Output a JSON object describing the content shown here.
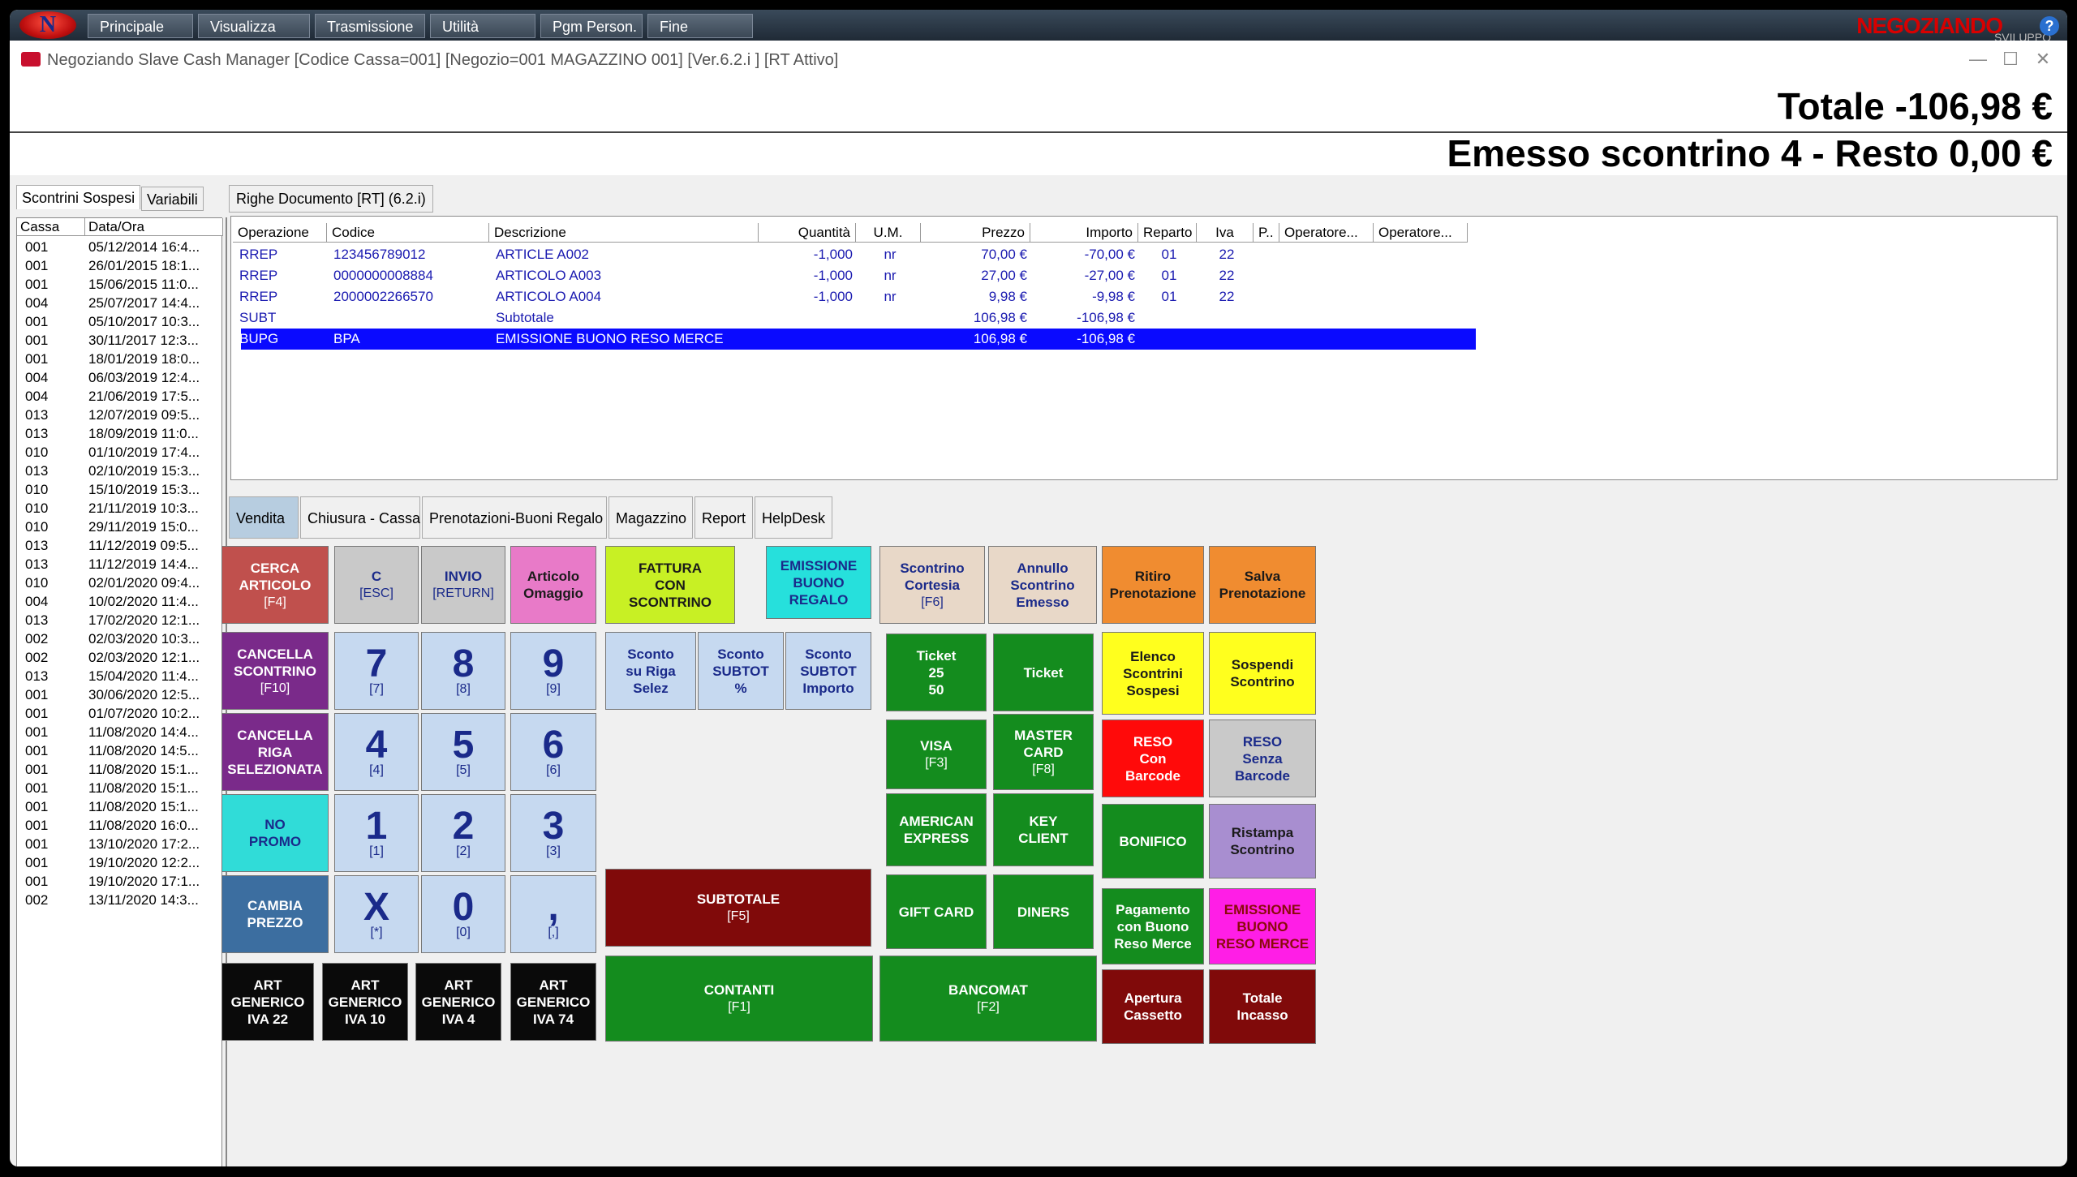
{
  "menubar": {
    "items": [
      "Principale",
      "Visualizza",
      "Trasmissione",
      "Utilità",
      "Pgm Person.",
      "Fine"
    ],
    "brand": "NEGOZIANDO",
    "brand_sub": "SVILUPPO",
    "logo": "N"
  },
  "window": {
    "title": "Negoziando Slave Cash Manager [Codice Cassa=001] [Negozio=001 MAGAZZINO 001] [Ver.6.2.i ] [RT Attivo]"
  },
  "totals": {
    "totale": "Totale -106,98 €",
    "emesso": "Emesso scontrino 4 - Resto  0,00 €"
  },
  "left_panel": {
    "tabs": [
      "Scontrini Sospesi",
      "Variabili"
    ],
    "headers": [
      "Cassa",
      "Data/Ora"
    ],
    "rows": [
      [
        "001",
        "05/12/2014 16:4..."
      ],
      [
        "001",
        "26/01/2015 18:1..."
      ],
      [
        "001",
        "15/06/2015 11:0..."
      ],
      [
        "004",
        "25/07/2017 14:4..."
      ],
      [
        "001",
        "05/10/2017 10:3..."
      ],
      [
        "001",
        "30/11/2017 12:3..."
      ],
      [
        "001",
        "18/01/2019 18:0..."
      ],
      [
        "004",
        "06/03/2019 12:4..."
      ],
      [
        "004",
        "21/06/2019 17:5..."
      ],
      [
        "013",
        "12/07/2019 09:5..."
      ],
      [
        "013",
        "18/09/2019 11:0..."
      ],
      [
        "010",
        "01/10/2019 17:4..."
      ],
      [
        "013",
        "02/10/2019 15:3..."
      ],
      [
        "010",
        "15/10/2019 15:3..."
      ],
      [
        "010",
        "21/11/2019 10:3..."
      ],
      [
        "010",
        "29/11/2019 15:0..."
      ],
      [
        "013",
        "11/12/2019 09:5..."
      ],
      [
        "013",
        "11/12/2019 14:4..."
      ],
      [
        "010",
        "02/01/2020 09:4..."
      ],
      [
        "004",
        "10/02/2020 11:4..."
      ],
      [
        "013",
        "17/02/2020 12:1..."
      ],
      [
        "002",
        "02/03/2020 10:3..."
      ],
      [
        "002",
        "02/03/2020 12:1..."
      ],
      [
        "013",
        "15/04/2020 11:4..."
      ],
      [
        "001",
        "30/06/2020 12:5..."
      ],
      [
        "001",
        "01/07/2020 10:2..."
      ],
      [
        "001",
        "11/08/2020 14:4..."
      ],
      [
        "001",
        "11/08/2020 14:5..."
      ],
      [
        "001",
        "11/08/2020 15:1..."
      ],
      [
        "001",
        "11/08/2020 15:1..."
      ],
      [
        "001",
        "11/08/2020 15:1..."
      ],
      [
        "001",
        "11/08/2020 16:0..."
      ],
      [
        "001",
        "13/10/2020 17:2..."
      ],
      [
        "001",
        "19/10/2020 12:2..."
      ],
      [
        "001",
        "19/10/2020 17:1..."
      ],
      [
        "002",
        "13/11/2020 14:3..."
      ]
    ]
  },
  "document": {
    "tab": "Righe Documento [RT] (6.2.i)",
    "headers": [
      "Operazione",
      "Codice",
      "Descrizione",
      "Quantità",
      "U.M.",
      "Prezzo",
      "Importo",
      "Reparto",
      "Iva",
      "P..",
      "Operatore...",
      "Operatore..."
    ],
    "rows": [
      [
        "RREP",
        "123456789012",
        "ARTICLE A002",
        "-1,000",
        "nr",
        "70,00 €",
        "-70,00 €",
        "01",
        "22"
      ],
      [
        "RREP",
        "0000000008884",
        "ARTICOLO A003",
        "-1,000",
        "nr",
        "27,00 €",
        "-27,00 €",
        "01",
        "22"
      ],
      [
        "RREP",
        "2000002266570",
        "ARTICOLO A004",
        "-1,000",
        "nr",
        "9,98 €",
        "-9,98 €",
        "01",
        "22"
      ],
      [
        "SUBT",
        "",
        "Subtotale",
        "",
        "",
        "106,98 €",
        "-106,98 €",
        "",
        ""
      ],
      [
        "BUPG",
        "BPA",
        "EMISSIONE BUONO RESO MERCE",
        "",
        "",
        "106,98 €",
        "-106,98 €",
        "",
        ""
      ]
    ],
    "selected_row": 4
  },
  "bottom_tabs": [
    "Vendita",
    "Chiusura - Cassa",
    "Prenotazioni-Buoni Regalo",
    "Magazzino",
    "Report",
    "HelpDesk"
  ],
  "keys": {
    "cerca": {
      "l": "CERCA\nARTICOLO",
      "s": "[F4]"
    },
    "c": {
      "l": "C",
      "s": "[ESC]"
    },
    "invio": {
      "l": "INVIO",
      "s": "[RETURN]"
    },
    "omaggio": {
      "l": "Articolo\nOmaggio",
      "s": ""
    },
    "fattura": {
      "l": "FATTURA\nCON\nSCONTRINO",
      "s": ""
    },
    "emissione_buono": {
      "l": "EMISSIONE\nBUONO\nREGALO",
      "s": ""
    },
    "cortesia": {
      "l": "Scontrino\nCortesia",
      "s": "[F6]"
    },
    "annullo": {
      "l": "Annullo\nScontrino\nEmesso",
      "s": ""
    },
    "ritiro": {
      "l": "Ritiro\nPrenotazione",
      "s": ""
    },
    "salva": {
      "l": "Salva\nPrenotazione",
      "s": ""
    },
    "canc_scontrino": {
      "l": "CANCELLA\nSCONTRINO",
      "s": "[F10]"
    },
    "sconto_riga": {
      "l": "Sconto\nsu Riga\nSelez",
      "s": ""
    },
    "sconto_perc": {
      "l": "Sconto\nSUBTOT\n%",
      "s": ""
    },
    "sconto_imp": {
      "l": "Sconto\nSUBTOT\nImporto",
      "s": ""
    },
    "ticket2550": {
      "l": "Ticket\n25\n50",
      "s": ""
    },
    "ticket": {
      "l": "Ticket",
      "s": ""
    },
    "elenco": {
      "l": "Elenco\nScontrini\nSospesi",
      "s": ""
    },
    "sospendi": {
      "l": "Sospendi\nScontrino",
      "s": ""
    },
    "canc_riga": {
      "l": "CANCELLA\nRIGA\nSELEZIONATA",
      "s": ""
    },
    "visa": {
      "l": "VISA",
      "s": "[F3]"
    },
    "master": {
      "l": "MASTER\nCARD",
      "s": "[F8]"
    },
    "reso_con": {
      "l": "RESO\nCon\nBarcode",
      "s": ""
    },
    "reso_senza": {
      "l": "RESO\nSenza\nBarcode",
      "s": ""
    },
    "no_promo": {
      "l": "NO\nPROMO",
      "s": ""
    },
    "amex": {
      "l": "AMERICAN\nEXPRESS",
      "s": ""
    },
    "key_client": {
      "l": "KEY\nCLIENT",
      "s": ""
    },
    "bonifico": {
      "l": "BONIFICO",
      "s": ""
    },
    "ristampa": {
      "l": "Ristampa\nScontrino",
      "s": ""
    },
    "cambia": {
      "l": "CAMBIA\nPREZZO",
      "s": ""
    },
    "subtotale": {
      "l": "SUBTOTALE",
      "s": "[F5]"
    },
    "gift": {
      "l": "GIFT CARD",
      "s": ""
    },
    "diners": {
      "l": "DINERS",
      "s": ""
    },
    "pag_buono": {
      "l": "Pagamento\ncon Buono\nReso Merce",
      "s": ""
    },
    "emissione_reso": {
      "l": "EMISSIONE\nBUONO\nRESO MERCE",
      "s": ""
    },
    "art22": {
      "l": "ART\nGENERICO\nIVA 22",
      "s": ""
    },
    "art10": {
      "l": "ART\nGENERICO\nIVA 10",
      "s": ""
    },
    "art4": {
      "l": "ART\nGENERICO\nIVA 4",
      "s": ""
    },
    "art74": {
      "l": "ART\nGENERICO\nIVA 74",
      "s": ""
    },
    "contanti": {
      "l": "CONTANTI",
      "s": "[F1]"
    },
    "bancomat": {
      "l": "BANCOMAT",
      "s": "[F2]"
    },
    "apertura": {
      "l": "Apertura\nCassetto",
      "s": ""
    },
    "totale_incasso": {
      "l": "Totale\nIncasso",
      "s": ""
    }
  },
  "numpad": [
    {
      "d": "7",
      "s": "[7]"
    },
    {
      "d": "8",
      "s": "[8]"
    },
    {
      "d": "9",
      "s": "[9]"
    },
    {
      "d": "4",
      "s": "[4]"
    },
    {
      "d": "5",
      "s": "[5]"
    },
    {
      "d": "6",
      "s": "[6]"
    },
    {
      "d": "1",
      "s": "[1]"
    },
    {
      "d": "2",
      "s": "[2]"
    },
    {
      "d": "3",
      "s": "[3]"
    },
    {
      "d": "X",
      "s": "[*]"
    },
    {
      "d": "0",
      "s": "[0]"
    },
    {
      "d": ",",
      "s": "[,]"
    }
  ]
}
